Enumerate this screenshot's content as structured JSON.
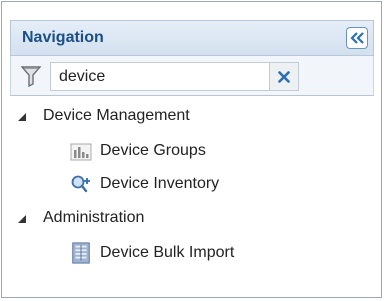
{
  "navigation": {
    "title": "Navigation",
    "collapse_icon": "double-chevron-left-icon",
    "filter": {
      "icon": "funnel-icon",
      "value": "device",
      "clear_icon": "clear-x-icon"
    },
    "tree": [
      {
        "label": "Device Management",
        "expanded": true,
        "children": [
          {
            "label": "Device Groups",
            "icon": "device-groups-icon"
          },
          {
            "label": "Device Inventory",
            "icon": "device-inventory-icon"
          }
        ]
      },
      {
        "label": "Administration",
        "expanded": true,
        "children": [
          {
            "label": "Device Bulk Import",
            "icon": "bulk-import-icon"
          }
        ]
      }
    ]
  },
  "colors": {
    "header_text": "#1a4f8a",
    "header_bg": "#dbe6f2",
    "clear_x": "#2c6fb5"
  }
}
